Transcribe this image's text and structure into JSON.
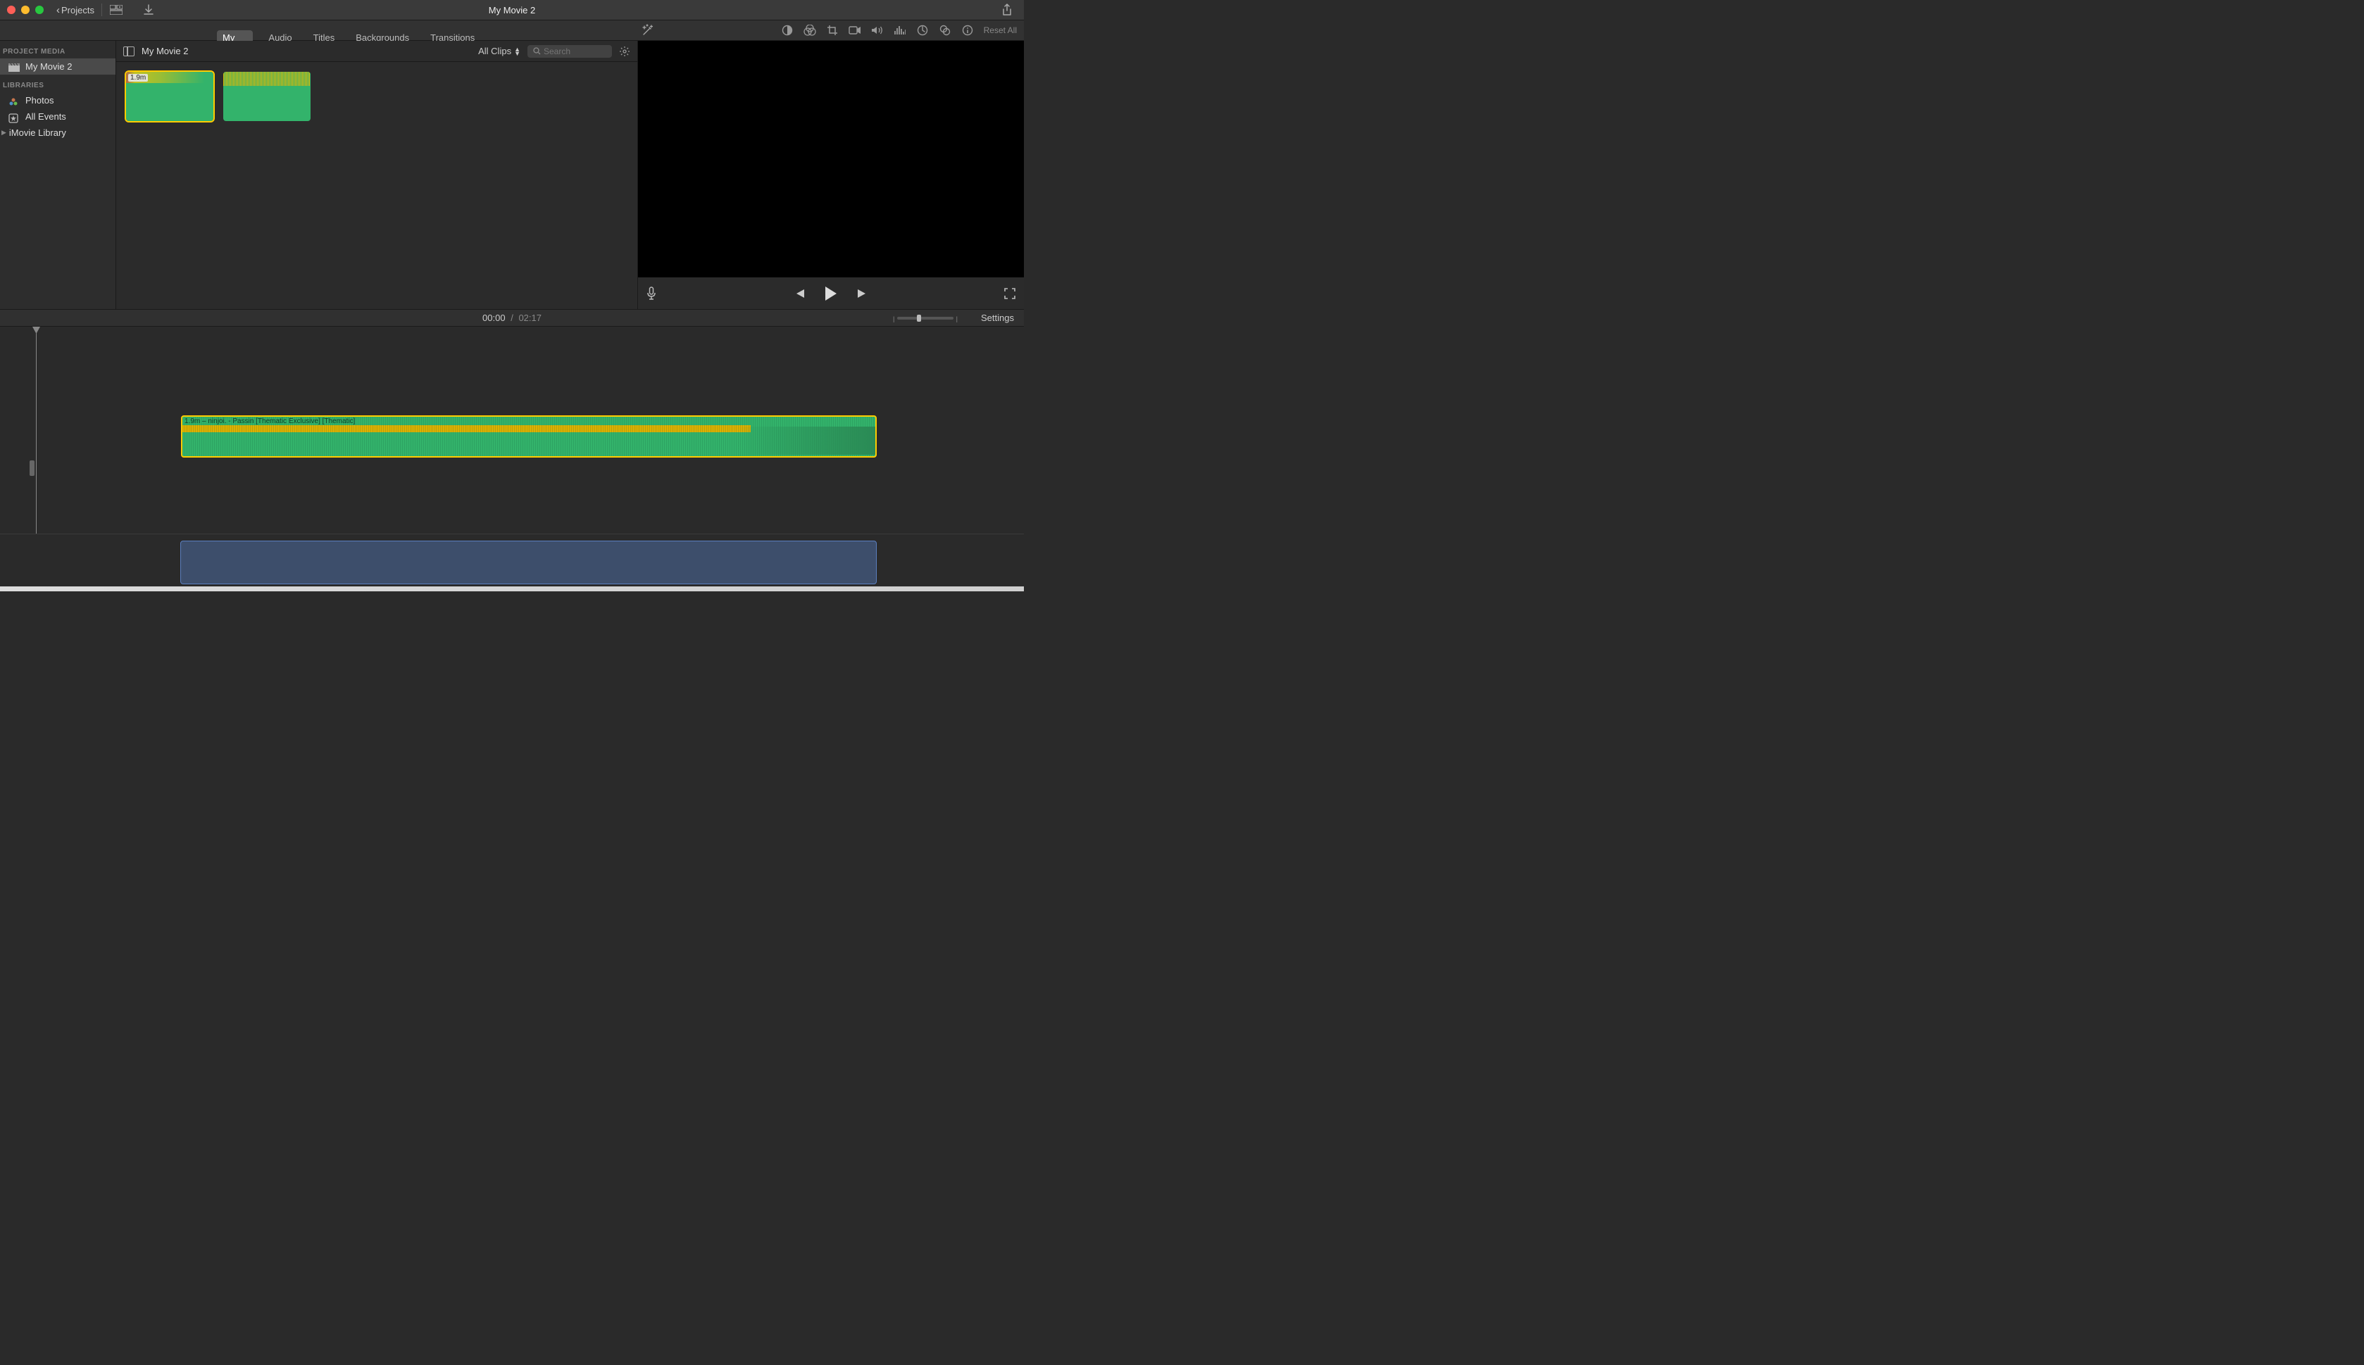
{
  "window": {
    "title": "My Movie 2",
    "back_label": "Projects"
  },
  "tabs": {
    "my_media": "My Media",
    "audio": "Audio",
    "titles": "Titles",
    "backgrounds": "Backgrounds",
    "transitions": "Transitions"
  },
  "reset_label": "Reset All",
  "sidebar": {
    "project_media_header": "PROJECT MEDIA",
    "project_name": "My Movie 2",
    "libraries_header": "LIBRARIES",
    "photos": "Photos",
    "all_events": "All Events",
    "imovie_library": "iMovie Library"
  },
  "browser": {
    "project_name": "My Movie 2",
    "filter_label": "All Clips",
    "search_placeholder": "Search",
    "clip1_duration": "1.9m"
  },
  "timeline": {
    "current": "00:00",
    "separator": "/",
    "duration": "02:17",
    "settings": "Settings",
    "audio_clip_label": "1.9m – ninjoi. - Passin [Thematic Exclusive] [Thematic]"
  }
}
